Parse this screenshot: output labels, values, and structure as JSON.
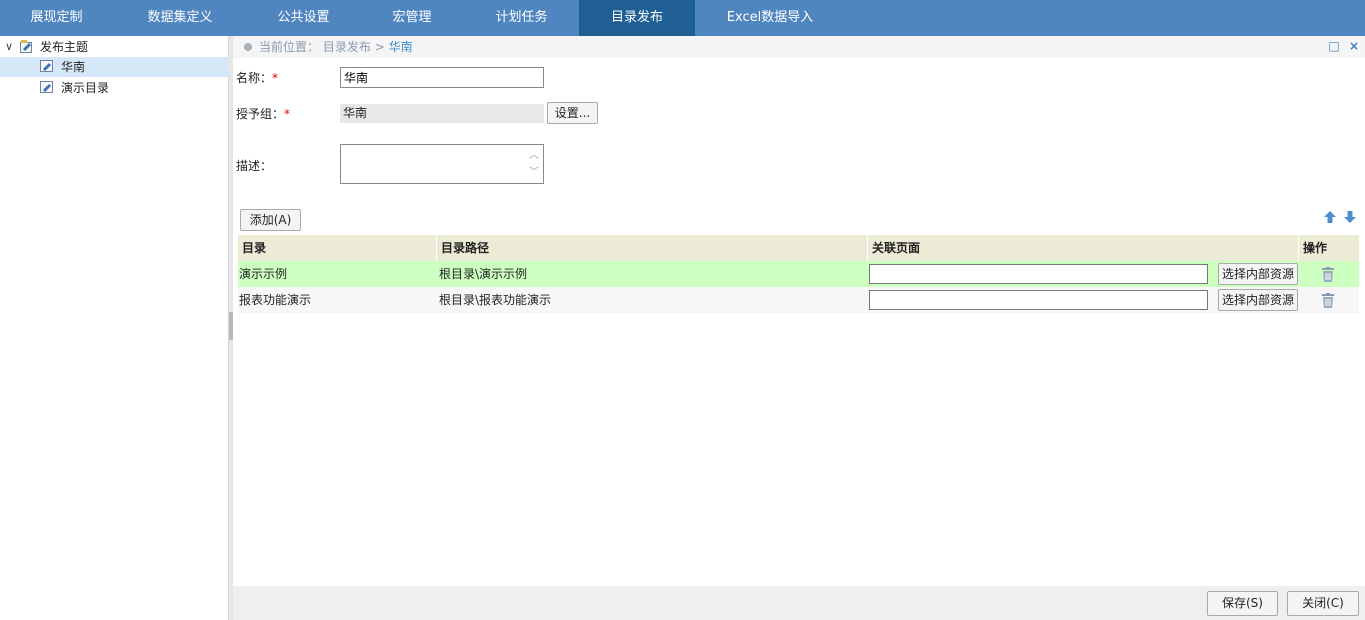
{
  "nav": {
    "tabs": [
      {
        "label": "展现定制"
      },
      {
        "label": "数据集定义"
      },
      {
        "label": "公共设置"
      },
      {
        "label": "宏管理"
      },
      {
        "label": "计划任务"
      },
      {
        "label": "目录发布"
      },
      {
        "label": "Excel数据导入"
      }
    ],
    "active_index": 5,
    "active_color": "#1f5f94",
    "bar_color": "#4f86c0"
  },
  "tree": {
    "root": {
      "label": "发布主题",
      "toggle": "∨"
    },
    "children": [
      {
        "label": "华南"
      },
      {
        "label": "演示目录"
      }
    ],
    "selected_child": 0
  },
  "breadcrumb": {
    "prefix": "当前位置：",
    "path": "目录发布",
    "separator": ">",
    "current": "华南"
  },
  "window_controls": {
    "maximize": "□",
    "close": "×"
  },
  "form": {
    "name_label": "名称：",
    "required_mark": "*",
    "name_value": "华南",
    "grant_label": "授予组：",
    "grant_value": "华南",
    "settings_button": "设置...",
    "desc_label": "描述：",
    "desc_value": ""
  },
  "toolbar": {
    "add_button": "添加(A)"
  },
  "grid": {
    "columns": [
      "目录",
      "目录路径",
      "关联页面",
      "操作"
    ],
    "rows": [
      {
        "dir": "演示示例",
        "path": "根目录\\演示示例",
        "page": "",
        "select_button": "选择内部资源",
        "highlight": true
      },
      {
        "dir": "报表功能演示",
        "path": "根目录\\报表功能演示",
        "page": "",
        "select_button": "选择内部资源",
        "highlight": false
      }
    ]
  },
  "footer": {
    "save_button": "保存(S)",
    "close_button": "关闭(C)"
  }
}
